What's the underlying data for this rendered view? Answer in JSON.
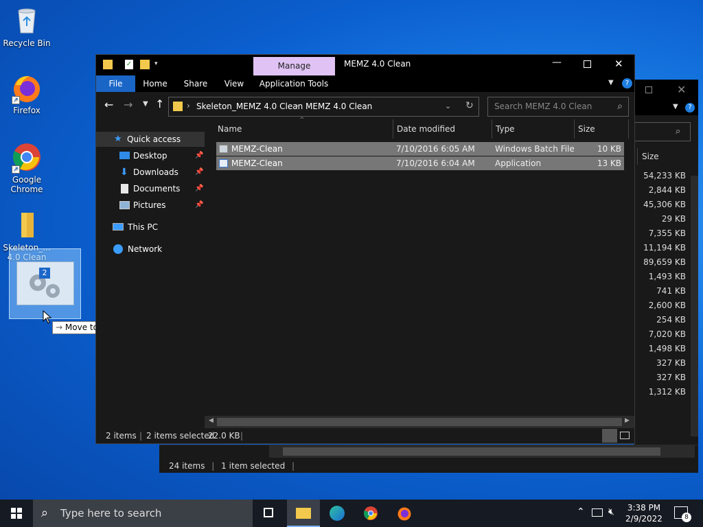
{
  "desktop": {
    "icons": [
      {
        "label": "Recycle Bin"
      },
      {
        "label": "Firefox"
      },
      {
        "label": "Google Chrome"
      },
      {
        "label": "Skeleton_... 4.0 Clean"
      }
    ],
    "drag_badge": "2",
    "drag_tooltip": "Move to Desktop",
    "drag_tooltip_arrow": "→"
  },
  "window": {
    "title": "MEMZ 4.0 Clean",
    "manage_label": "Manage",
    "ribbon_tabs": [
      "File",
      "Home",
      "Share",
      "View",
      "Application Tools"
    ],
    "breadcrumb": [
      "Skeleton_MEMZ 4.0 Clean",
      "MEMZ 4.0 Clean"
    ],
    "search_placeholder": "Search MEMZ 4.0 Clean",
    "nav": {
      "quick_access": "Quick access",
      "items": [
        "Desktop",
        "Downloads",
        "Documents",
        "Pictures"
      ],
      "this_pc": "This PC",
      "network": "Network"
    },
    "columns": [
      "Name",
      "Date modified",
      "Type",
      "Size"
    ],
    "files": [
      {
        "name": "MEMZ-Clean",
        "date": "7/10/2016 6:05 AM",
        "type": "Windows Batch File",
        "size": "10 KB"
      },
      {
        "name": "MEMZ-Clean",
        "date": "7/10/2016 6:04 AM",
        "type": "Application",
        "size": "13 KB"
      }
    ],
    "status": {
      "items": "2 items",
      "selected": "2 items selected",
      "size": "22.0 KB"
    }
  },
  "back_window": {
    "size_header": "Size",
    "sizes": [
      "54,233 KB",
      "2,844 KB",
      "45,306 KB",
      "29 KB",
      "7,355 KB",
      "11,194 KB",
      "89,659 KB",
      "1,493 KB",
      "741 KB",
      "2,600 KB",
      "254 KB",
      "7,020 KB",
      "1,498 KB",
      "327 KB",
      "327 KB",
      "1,312 KB"
    ],
    "status_items": "24 items",
    "status_selected": "1 item selected"
  },
  "taskbar": {
    "search_placeholder": "Type here to search",
    "time": "3:38 PM",
    "date": "2/9/2022",
    "notification_count": "8"
  },
  "colors": {
    "accent": "#0078d7",
    "manage_tab": "#e0c3f4",
    "selection": "#777777"
  }
}
